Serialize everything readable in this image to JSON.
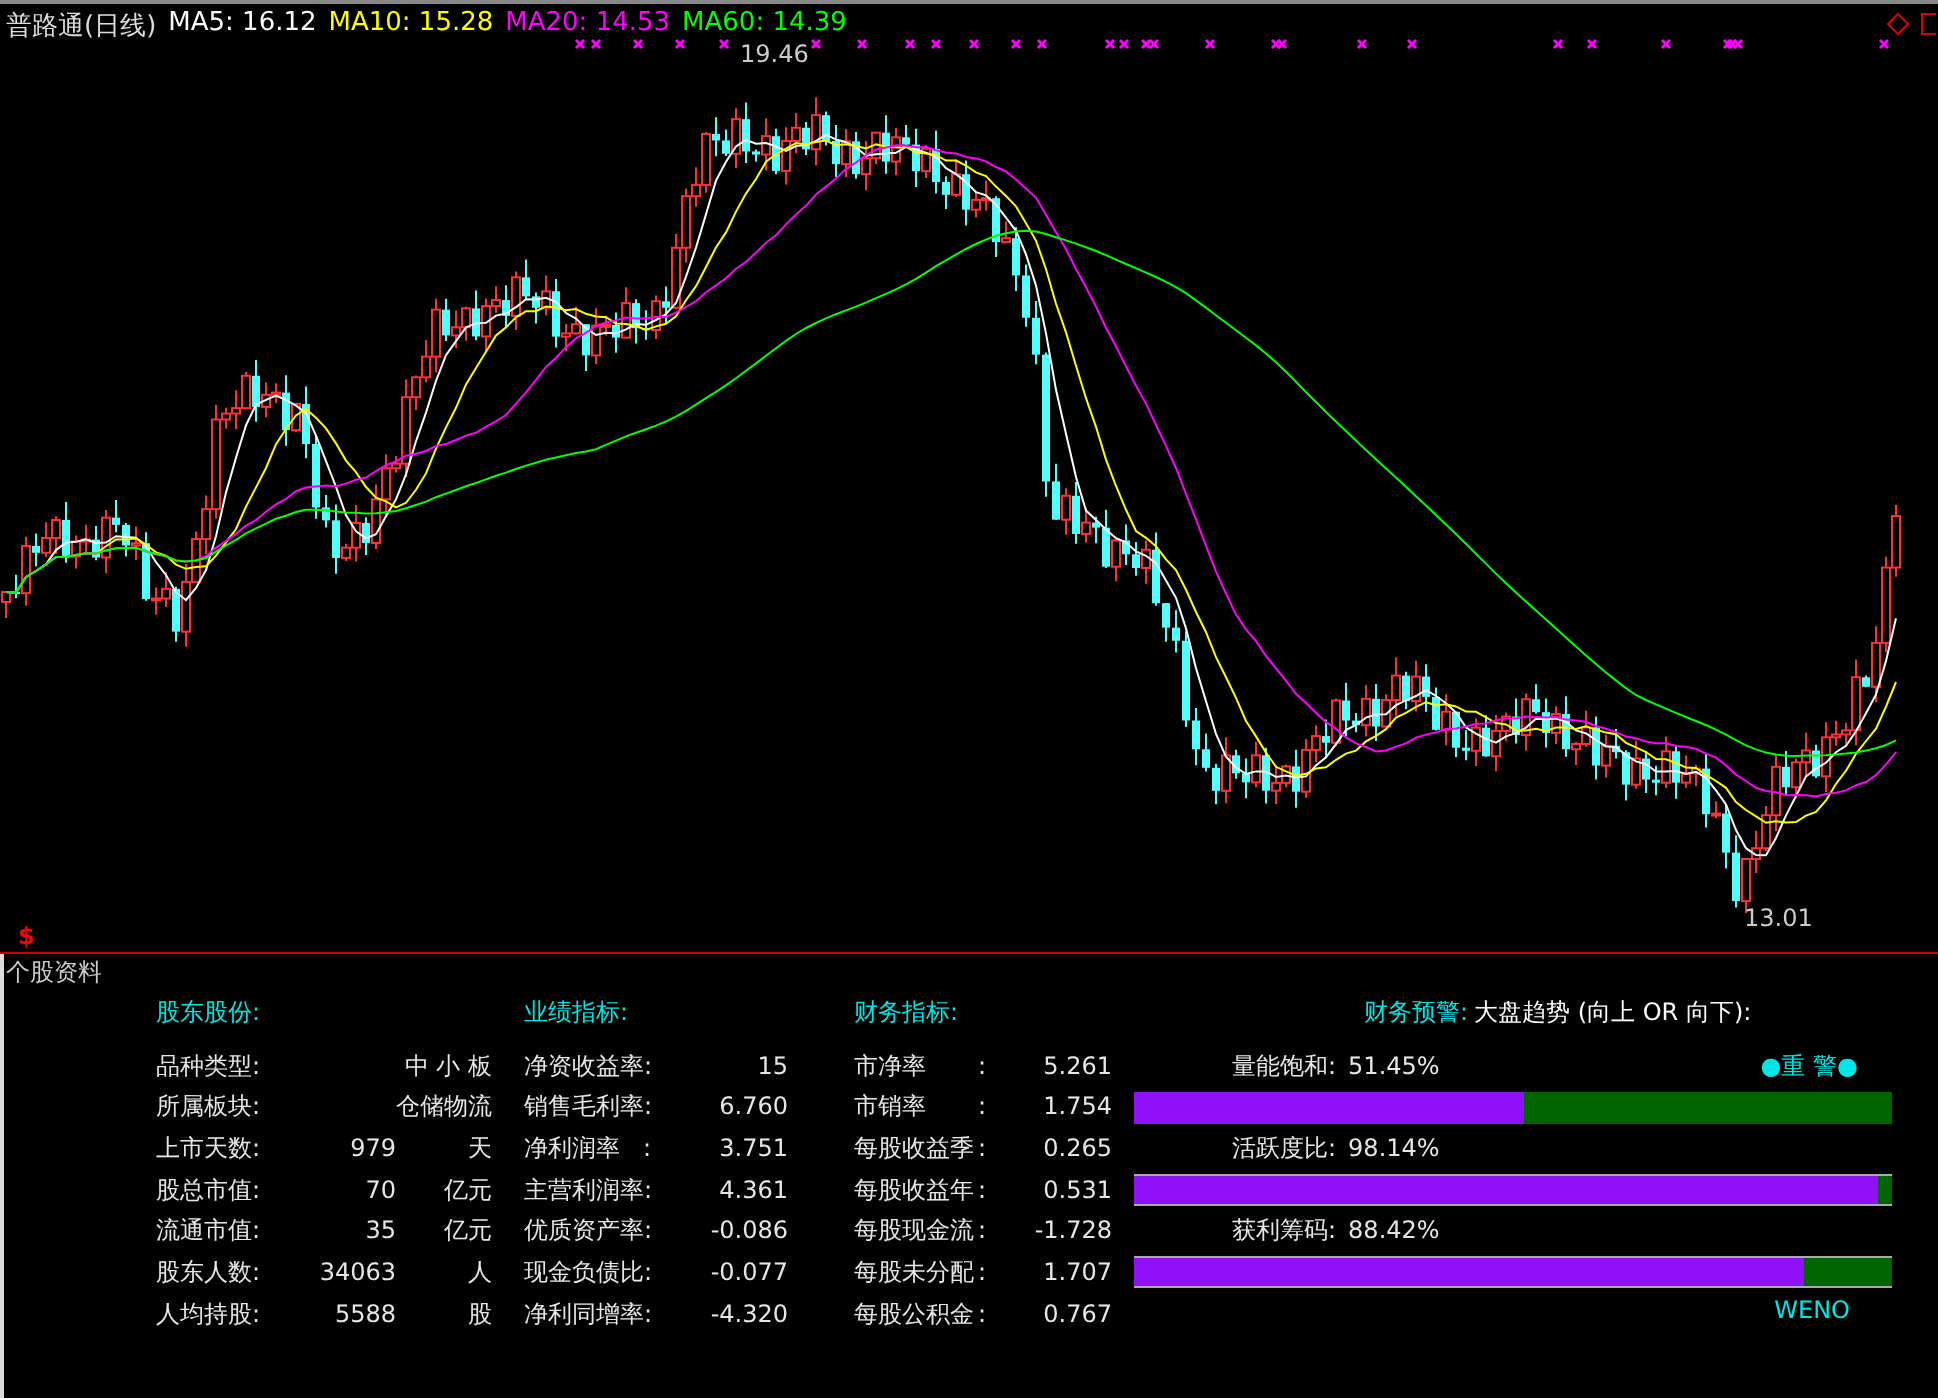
{
  "chart": {
    "title": "普路通(日线)",
    "marker": "$",
    "high_label": "19.46",
    "low_label": "13.01",
    "ma": [
      {
        "label": "MA5: 16.12",
        "color": "#ffffff"
      },
      {
        "label": "MA10: 15.28",
        "color": "#ffff00"
      },
      {
        "label": "MA20: 14.53",
        "color": "#ff00ff"
      },
      {
        "label": "MA60: 14.39",
        "color": "#00ff00"
      }
    ]
  },
  "panel": {
    "title": "个股资料",
    "shareholding": {
      "heading": "股东股份:",
      "rows": [
        {
          "label": "品种类型:",
          "value": "中 小 板"
        },
        {
          "label": "所属板块:",
          "value": "仓储物流"
        },
        {
          "label": "上市天数:",
          "value": "979",
          "unit": "天"
        },
        {
          "label": "股总市值:",
          "value": "70",
          "unit": "亿元"
        },
        {
          "label": "流通市值:",
          "value": "35",
          "unit": "亿元"
        },
        {
          "label": "股东人数:",
          "value": "34063",
          "unit": "人"
        },
        {
          "label": "人均持股:",
          "value": "5588",
          "unit": "股"
        }
      ]
    },
    "performance": {
      "heading": "业绩指标:",
      "rows": [
        {
          "label": "净资收益率:",
          "value": "15"
        },
        {
          "label": "销售毛利率:",
          "value": "6.760"
        },
        {
          "label": "净利润率   :",
          "value": "3.751"
        },
        {
          "label": "主营利润率:",
          "value": "4.361"
        },
        {
          "label": "优质资产率:",
          "value": "-0.086"
        },
        {
          "label": "现金负债比:",
          "value": "-0.077"
        },
        {
          "label": "净利同增率:",
          "value": "-4.320"
        }
      ]
    },
    "financial": {
      "heading": "财务指标:",
      "rows": [
        {
          "label": "市净率",
          "colon": ":",
          "value": "5.261"
        },
        {
          "label": "市销率",
          "colon": ":",
          "value": "1.754"
        },
        {
          "label": "每股收益季",
          "colon": ":",
          "value": "0.265"
        },
        {
          "label": "每股收益年",
          "colon": ":",
          "value": "0.531"
        },
        {
          "label": "每股现金流",
          "colon": ":",
          "value": "-1.728"
        },
        {
          "label": "每股未分配",
          "colon": ":",
          "value": "1.707"
        },
        {
          "label": "每股公积金",
          "colon": ":",
          "value": "0.767"
        }
      ]
    },
    "warning": {
      "heading": "财务预警:",
      "trend": "大盘趋势 (向上 OR 向下):",
      "badge": "●重 警●",
      "footer": "WENO",
      "bars": [
        {
          "label": "量能饱和:",
          "reading": "51.45%",
          "level": 0.514
        },
        {
          "label": "活跃度比:",
          "reading": "98.14%",
          "level": 0.981
        },
        {
          "label": "获利筹码:",
          "reading": "88.42%",
          "level": 0.884
        }
      ]
    }
  }
}
